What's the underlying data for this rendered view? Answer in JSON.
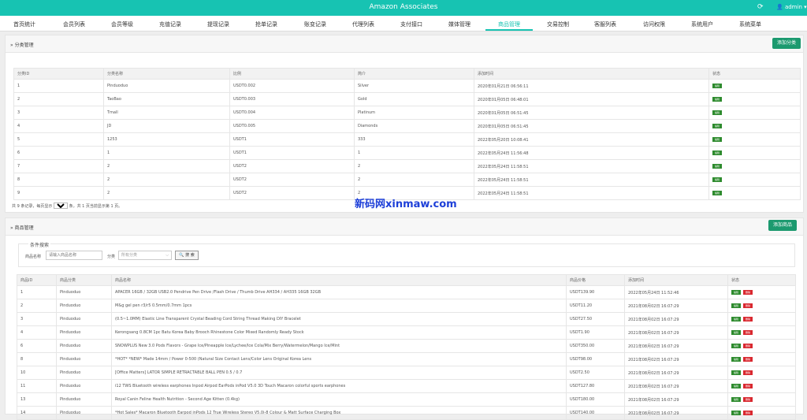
{
  "app": {
    "title": "Amazon Associates",
    "user": "admin",
    "refresh_icon": "refresh-icon",
    "user_icon": "user-icon"
  },
  "nav": {
    "tabs": [
      "首页统计",
      "会员列表",
      "会员等级",
      "充值记录",
      "提现记录",
      "抢单记录",
      "账变记录",
      "代理列表",
      "支付接口",
      "媒体管理",
      "商品管理",
      "交易控制",
      "客服列表",
      "访问权限",
      "系统用户",
      "系统菜单"
    ],
    "active": "商品管理"
  },
  "category_panel": {
    "title": "分类管理",
    "add_button": "添加分类",
    "columns": [
      "分类ID",
      "分类名称",
      "比例",
      "简介",
      "添加时间",
      "状态"
    ],
    "rows": [
      {
        "id": "1",
        "name": "Pinduoduo",
        "ratio": "USDT0.002",
        "intro": "Silver",
        "time": "2020年01月21日 06:56:11",
        "status": "编辑"
      },
      {
        "id": "2",
        "name": "TaoBao",
        "ratio": "USDT0.003",
        "intro": "Gold",
        "time": "2020年01月05日 06:48:01",
        "status": "编辑"
      },
      {
        "id": "3",
        "name": "Tmall",
        "ratio": "USDT0.004",
        "intro": "Platinum",
        "time": "2020年01月05日 06:51:45",
        "status": "编辑"
      },
      {
        "id": "4",
        "name": "JD",
        "ratio": "USDT0.005",
        "intro": "Diamonds",
        "time": "2020年01月05日 06:51:45",
        "status": "编辑"
      },
      {
        "id": "5",
        "name": "1253",
        "ratio": "USDT1",
        "intro": "333",
        "time": "2022年05月20日 10:08:41",
        "status": "编辑"
      },
      {
        "id": "6",
        "name": "1",
        "ratio": "USDT1",
        "intro": "1",
        "time": "2022年05月24日 11:56:48",
        "status": "编辑"
      },
      {
        "id": "7",
        "name": "2",
        "ratio": "USDT2",
        "intro": "2",
        "time": "2022年05月24日 11:58:51",
        "status": "编辑"
      },
      {
        "id": "8",
        "name": "2",
        "ratio": "USDT2",
        "intro": "2",
        "time": "2022年05月24日 11:58:51",
        "status": "编辑"
      },
      {
        "id": "9",
        "name": "2",
        "ratio": "USDT2",
        "intro": "2",
        "time": "2022年05月24日 11:58:51",
        "status": "编辑"
      }
    ],
    "pager_prefix": "共 9 条记录，每页显示",
    "pager_size": "20",
    "pager_suffix": "条，共 1 页当前显示第 1 页。"
  },
  "watermark": "新码网xinmaw.com",
  "goods_panel": {
    "title": "商品管理",
    "add_button": "添加商品",
    "search": {
      "legend": "条件搜索",
      "name_label": "商品名称",
      "name_placeholder": "请输入商品名称",
      "cat_label": "分类",
      "cat_value": "所有分类",
      "search_button": "搜 索"
    },
    "columns": [
      "商品ID",
      "商品分类",
      "商品名称",
      "商品价格",
      "添加时间",
      "状态"
    ],
    "rows": [
      {
        "id": "1",
        "cat": "Pinduoduo",
        "name": "APACER 16GB / 32GB USB2.0 Pendrive Pen Drive /Flash Drive / Thumb Drive AH334 / AH335 16GB 32GB",
        "price": "USDT139.90",
        "time": "2022年05月24日 11:52:46"
      },
      {
        "id": "2",
        "cat": "Pinduoduo",
        "name": "M&g gel pen r3/r5 0.5mm/0.7mm 1pcs",
        "price": "USDT11.20",
        "time": "2021年08月02日 16:07:29"
      },
      {
        "id": "3",
        "cat": "Pinduoduo",
        "name": "(0.5~1.0MM) Elastic Line Transparent Crystal Beading Cord String Thread Making DIY Bracelet",
        "price": "USDT27.50",
        "time": "2021年08月02日 16:07:29"
      },
      {
        "id": "4",
        "cat": "Pinduoduo",
        "name": "Kerongsang 0.8CM 1pc Batu Korea Baby Brooch Rhinestone Color Mixed Randomly Ready Stock",
        "price": "USDT1.90",
        "time": "2021年08月02日 16:07:29"
      },
      {
        "id": "6",
        "cat": "Pinduoduo",
        "name": "SNOWPLUS New 3.0 Pods Flavors - Grape Ice/Pineapple Ice/Lychee/Ice Cola/Mix Berry/Watermelon/Mango Ice/Mint",
        "price": "USDT350.00",
        "time": "2021年08月02日 16:07:29"
      },
      {
        "id": "8",
        "cat": "Pinduoduo",
        "name": "*HOT* *NEW* Made 14mm / Power 0-500 (Natural Size Contact Lens/Color Lens Original Korea Lens",
        "price": "USDT98.00",
        "time": "2021年08月02日 16:07:29"
      },
      {
        "id": "10",
        "cat": "Pinduoduo",
        "name": "[Office Matters] LATOR SIMPLE RETRACTABLE BALL PEN 0.5 / 0.7",
        "price": "USDT2.50",
        "time": "2021年08月02日 16:07:29"
      },
      {
        "id": "11",
        "cat": "Pinduoduo",
        "name": "i12 TWS Bluetooth wireless earphones Inpod Airpod EarPods inPod V5.0 3D Touch Macaron colorful sports earphones",
        "price": "USDT127.80",
        "time": "2021年08月02日 16:07:29"
      },
      {
        "id": "13",
        "cat": "Pinduoduo",
        "name": "Royal Canin Feline Health Nutrition - Second Age Kitten (0.4kg)",
        "price": "USDT180.00",
        "time": "2021年08月02日 16:07:29"
      },
      {
        "id": "14",
        "cat": "Pinduoduo",
        "name": "*Hot Sales* Macaron Bluetooth Earpod inPods 12 True Wireless Stereo V5.0i-8 Colour & Matt Surface Charging Box",
        "price": "USDT140.00",
        "time": "2021年08月02日 16:07:29"
      }
    ],
    "edit_label": "编辑",
    "delete_label": "删除"
  }
}
